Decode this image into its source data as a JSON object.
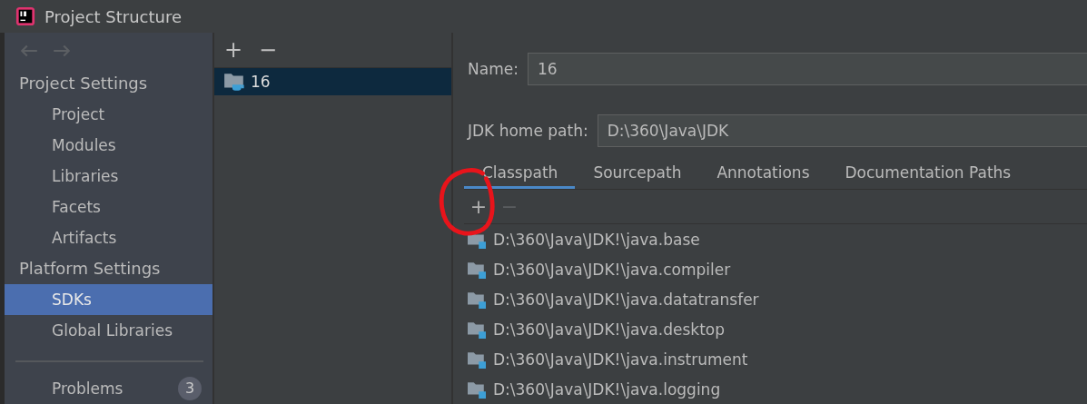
{
  "window": {
    "title": "Project Structure"
  },
  "sidebar": {
    "sections": [
      {
        "title": "Project Settings",
        "items": [
          {
            "label": "Project",
            "selected": false
          },
          {
            "label": "Modules",
            "selected": false
          },
          {
            "label": "Libraries",
            "selected": false
          },
          {
            "label": "Facets",
            "selected": false
          },
          {
            "label": "Artifacts",
            "selected": false
          }
        ]
      },
      {
        "title": "Platform Settings",
        "items": [
          {
            "label": "SDKs",
            "selected": true
          },
          {
            "label": "Global Libraries",
            "selected": false
          }
        ]
      }
    ],
    "problems": {
      "label": "Problems",
      "count": "3"
    }
  },
  "sdk_list": {
    "toolbar": [
      "+",
      "−"
    ],
    "items": [
      {
        "label": "16",
        "selected": true
      }
    ]
  },
  "details": {
    "name": {
      "label": "Name:",
      "value": "16"
    },
    "home_path": {
      "label": "JDK home path:",
      "value": "D:\\360\\Java\\JDK"
    },
    "tabs": [
      {
        "label": "Classpath",
        "selected": true
      },
      {
        "label": "Sourcepath",
        "selected": false
      },
      {
        "label": "Annotations",
        "selected": false
      },
      {
        "label": "Documentation Paths",
        "selected": false
      }
    ],
    "toolbar": [
      {
        "label": "+",
        "disabled": false
      },
      {
        "label": "−",
        "disabled": true
      }
    ],
    "classpath": [
      "D:\\360\\Java\\JDK!\\java.base",
      "D:\\360\\Java\\JDK!\\java.compiler",
      "D:\\360\\Java\\JDK!\\java.datatransfer",
      "D:\\360\\Java\\JDK!\\java.desktop",
      "D:\\360\\Java\\JDK!\\java.instrument",
      "D:\\360\\Java\\JDK!\\java.logging"
    ]
  }
}
